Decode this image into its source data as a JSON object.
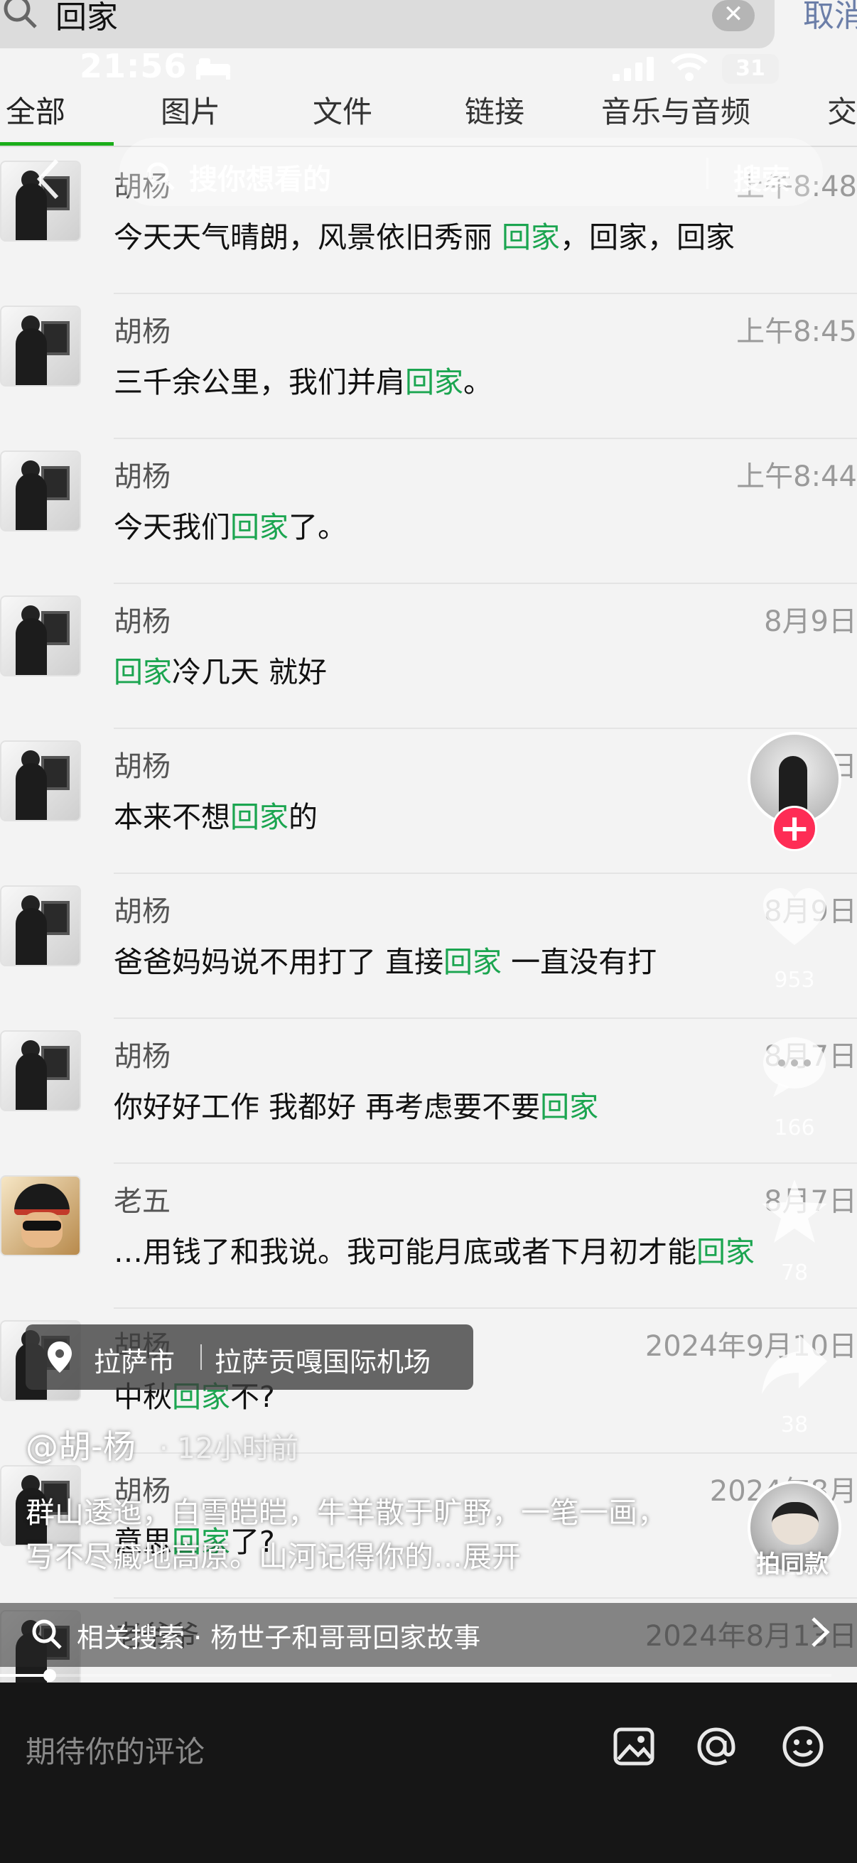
{
  "search": {
    "value": "回家",
    "clear_glyph": "✕",
    "cancel_label": "取消"
  },
  "status_bar": {
    "time": "21:56",
    "battery": "31"
  },
  "tabs": [
    "全部",
    "图片",
    "文件",
    "链接",
    "音乐与音频",
    "交"
  ],
  "overlay_search": {
    "placeholder": "搜你想看的",
    "button": "搜索"
  },
  "messages": [
    {
      "name": "胡杨",
      "time": "上午8:48",
      "parts": [
        [
          "今天天气晴朗，风景依旧秀丽 ",
          false
        ],
        [
          "回家",
          true
        ],
        [
          "，回家，回家",
          false
        ]
      ],
      "avatar": "default"
    },
    {
      "name": "胡杨",
      "time": "上午8:45",
      "parts": [
        [
          "三千余公里，我们并肩",
          false
        ],
        [
          "回家",
          true
        ],
        [
          "。",
          false
        ]
      ],
      "avatar": "default"
    },
    {
      "name": "胡杨",
      "time": "上午8:44",
      "parts": [
        [
          "今天我们",
          false
        ],
        [
          "回家",
          true
        ],
        [
          "了。",
          false
        ]
      ],
      "avatar": "default"
    },
    {
      "name": "胡杨",
      "time": "8月9日",
      "parts": [
        [
          "回家",
          true
        ],
        [
          "冷几天 就好",
          false
        ]
      ],
      "avatar": "default"
    },
    {
      "name": "胡杨",
      "time": "8月9日",
      "parts": [
        [
          "本来不想",
          false
        ],
        [
          "回家",
          true
        ],
        [
          "的",
          false
        ]
      ],
      "avatar": "default"
    },
    {
      "name": "胡杨",
      "time": "8月9日",
      "parts": [
        [
          "爸爸妈妈说不用打了 直接",
          false
        ],
        [
          "回家",
          true
        ],
        [
          " 一直没有打",
          false
        ]
      ],
      "avatar": "default"
    },
    {
      "name": "胡杨",
      "time": "8月7日",
      "parts": [
        [
          "你好好工作 我都好 再考虑要不要",
          false
        ],
        [
          "回家",
          true
        ]
      ],
      "avatar": "default"
    },
    {
      "name": "老五",
      "time": "8月7日",
      "parts": [
        [
          "…用钱了和我说。我可能月底或者下月初才能",
          false
        ],
        [
          "回家",
          true
        ]
      ],
      "avatar": "alt"
    },
    {
      "name": "胡杨",
      "time": "2024年9月10日",
      "parts": [
        [
          "中秋",
          false
        ],
        [
          "回家",
          true
        ],
        [
          "不?",
          false
        ]
      ],
      "avatar": "default"
    },
    {
      "name": "胡杨",
      "time": "2024年8月",
      "parts": [
        [
          "意思",
          false
        ],
        [
          "回家",
          true
        ],
        [
          "了?",
          false
        ]
      ],
      "avatar": "default"
    },
    {
      "name": "老爷爷",
      "time": "2024年8月13日",
      "parts": [
        [
          "",
          false
        ]
      ],
      "avatar": "default"
    }
  ],
  "rail": {
    "like_count": "953",
    "comment_count": "166",
    "favorite_count": "78",
    "share_count": "38",
    "same_label": "拍同款"
  },
  "location": {
    "city": "拉萨市",
    "place": "拉萨贡嘎国际机场"
  },
  "post": {
    "author": "@胡-杨",
    "time": "· 12小时前",
    "caption": "群山逶迤，白雪皑皑，牛羊散于旷野，一笔一画，写不尽藏地高原。山河记得你的…展开"
  },
  "related": {
    "text": "相关搜索 · 杨世子和哥哥回家故事"
  },
  "progress": {
    "fraction": 0.06
  },
  "comment_bar": {
    "placeholder": "期待你的评论"
  },
  "icons": [
    "search-icon",
    "clear-icon",
    "bed-icon",
    "signal-icon",
    "wifi-icon",
    "back-icon",
    "heart-icon",
    "comment-icon",
    "star-icon",
    "share-icon",
    "location-icon",
    "chevron-right-icon",
    "image-icon",
    "at-icon",
    "emoji-icon"
  ]
}
